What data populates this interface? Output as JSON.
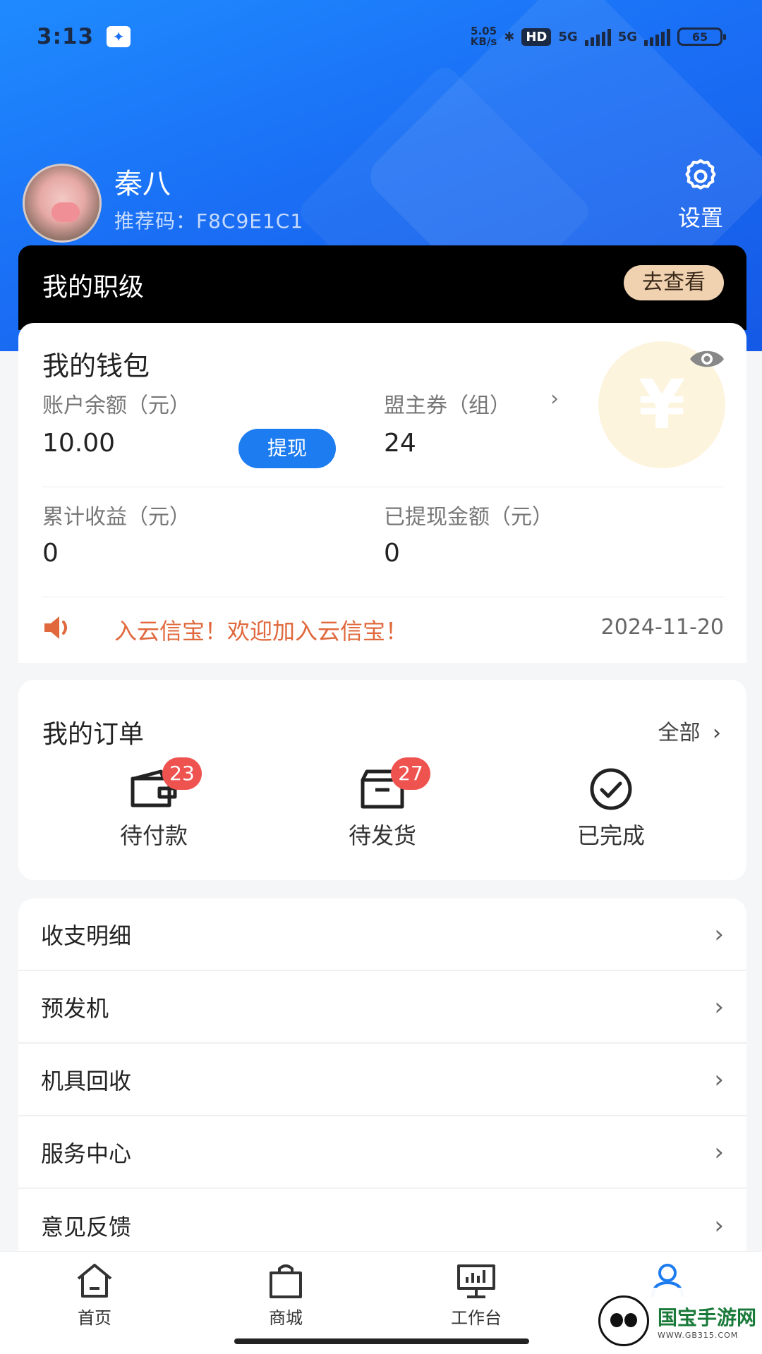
{
  "status_bar": {
    "time": "3:13",
    "net_speed": "5.05",
    "net_unit": "KB/s",
    "hd": "HD",
    "net1": "5G",
    "net2": "5G",
    "battery": "65"
  },
  "profile": {
    "name": "秦八",
    "referral": "推荐码：F8C9E1C1",
    "settings_label": "设置"
  },
  "rank": {
    "title": "我的职级",
    "button": "去查看"
  },
  "wallet": {
    "title": "我的钱包",
    "coin_symbol": "¥",
    "balance_label": "账户余额（元）",
    "balance_value": "10.00",
    "withdraw_button": "提现",
    "coupon_label": "盟主券（组）",
    "coupon_value": "24",
    "earnings_label": "累计收益（元）",
    "earnings_value": "0",
    "withdrawn_label": "已提现金额（元）",
    "withdrawn_value": "0",
    "notice_text": "入云信宝！欢迎加入云信宝！",
    "notice_date": "2024-11-20"
  },
  "orders": {
    "title": "我的订单",
    "all_label": "全部",
    "items": [
      {
        "label": "待付款",
        "badge": "23",
        "icon": "wallet-icon"
      },
      {
        "label": "待发货",
        "badge": "27",
        "icon": "box-icon"
      },
      {
        "label": "已完成",
        "badge": "",
        "icon": "check-circle-icon"
      }
    ]
  },
  "menu": {
    "items": [
      {
        "label": "收支明细"
      },
      {
        "label": "预发机"
      },
      {
        "label": "机具回收"
      },
      {
        "label": "服务中心"
      },
      {
        "label": "意见反馈"
      }
    ]
  },
  "tabbar": {
    "items": [
      {
        "label": "首页",
        "icon": "home-icon"
      },
      {
        "label": "商城",
        "icon": "shopping-bag-icon"
      },
      {
        "label": "工作台",
        "icon": "workbench-icon"
      },
      {
        "label": "",
        "icon": "user-icon"
      }
    ]
  },
  "watermark": {
    "title": "国宝手游网",
    "sub": "WWW.GB315.COM"
  },
  "colors": {
    "primary": "#1c7cf0",
    "header_gradient_start": "#1f8bff",
    "header_gradient_end": "#1559e6",
    "badge": "#ef5350",
    "notice": "#e0683c",
    "rank_button": "#f0d2b1"
  }
}
